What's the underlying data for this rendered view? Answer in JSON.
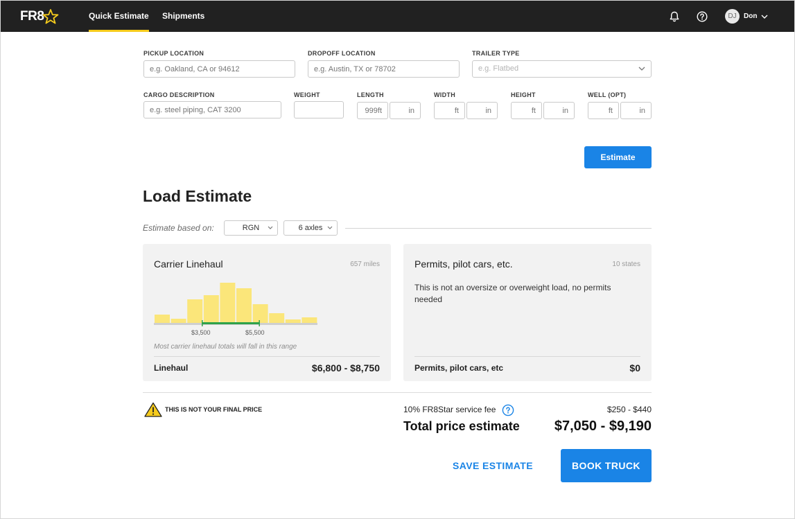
{
  "nav": {
    "logo": "FR8",
    "tabs": [
      {
        "label": "Quick Estimate",
        "active": true
      },
      {
        "label": "Shipments",
        "active": false
      }
    ],
    "icons": [
      "bell-icon",
      "help-icon"
    ],
    "user": {
      "initials": "DJ",
      "name": "Don"
    }
  },
  "form": {
    "pickup": {
      "label": "PICKUP LOCATION",
      "placeholder": "e.g. Oakland, CA or 94612",
      "value": ""
    },
    "dropoff": {
      "label": "DROPOFF LOCATION",
      "placeholder": "e.g. Austin, TX or 78702",
      "value": ""
    },
    "trailer": {
      "label": "TRAILER TYPE",
      "placeholder": "e.g. Flatbed",
      "value": ""
    },
    "cargo": {
      "label": "CARGO DESCRIPTION",
      "placeholder": "e.g. steel piping, CAT 3200",
      "value": ""
    },
    "weight": {
      "label": "WEIGHT",
      "placeholder": "",
      "value": ""
    },
    "length": {
      "label": "LENGTH",
      "ft_placeholder": "999ft",
      "in_placeholder": "in"
    },
    "width": {
      "label": "WIDTH",
      "ft_placeholder": "ft",
      "in_placeholder": "in"
    },
    "height": {
      "label": "HEIGHT",
      "ft_placeholder": "ft",
      "in_placeholder": "in"
    },
    "well": {
      "label": "WELL (OPT)",
      "ft_placeholder": "ft",
      "in_placeholder": "in"
    },
    "estimate_button": "Estimate"
  },
  "estimate": {
    "title": "Load Estimate",
    "based_on_label": "Estimate based on:",
    "trailer_select": "RGN",
    "axles_select": "6 axles"
  },
  "linehaul_card": {
    "title": "Carrier Linehaul",
    "meta": "657 miles",
    "histogram": {
      "bars": [
        0.12,
        0.06,
        0.34,
        0.4,
        0.58,
        0.5,
        0.27,
        0.14,
        0.05,
        0.08
      ],
      "range_start_bar": 3,
      "range_end_bar": 6
    },
    "range_low_tick": "$3,500",
    "range_high_tick": "$5,500",
    "note": "Most carrier linehaul totals will fall in this range",
    "foot_label": "Linehaul",
    "foot_value": "$6,800 - $8,750"
  },
  "permits_card": {
    "title": "Permits, pilot cars, etc.",
    "meta": "10 states",
    "text": "This is not an oversize or overweight load, no permits needed",
    "foot_label": "Permits, pilot cars, etc",
    "foot_value": "$0"
  },
  "summary": {
    "warning": "THIS IS NOT YOUR FINAL PRICE",
    "fee_label": "10% FR8Star service fee",
    "fee_value": "$250 - $440",
    "total_label": "Total price estimate",
    "total_value": "$7,050 - $9,190",
    "save_button": "SAVE ESTIMATE",
    "book_button": "BOOK TRUCK"
  },
  "colors": {
    "nav_bg": "#212121",
    "accent_yellow": "#f6cb1c",
    "primary_blue": "#1a84e6",
    "bar_yellow": "#fbe67a",
    "range_green": "#2ea24a"
  }
}
